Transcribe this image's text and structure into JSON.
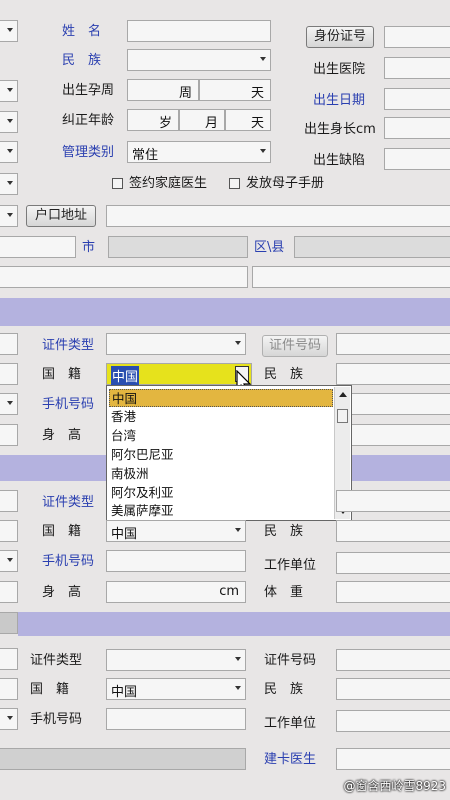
{
  "top": {
    "name_label": "姓　名",
    "ethnicity_label": "民　族",
    "birth_gestation_label": "出生孕周",
    "gestation_week_unit": "周",
    "gestation_day_unit": "天",
    "corrected_age_label": "纠正年龄",
    "age_year_unit": "岁",
    "age_month_unit": "月",
    "age_day_unit": "天",
    "management_type_label": "管理类别",
    "management_type_value": "常住",
    "id_number_button": "身份证号",
    "birth_hospital_label": "出生医院",
    "birth_date_label": "出生日期",
    "birth_height_label": "出生身长cm",
    "birth_defect_label": "出生缺陷",
    "family_doctor_checkbox": "签约家庭医生",
    "maternal_handbook_checkbox": "发放母子手册",
    "household_address_button": "户口地址",
    "city_label": "市",
    "district_label": "区\\县"
  },
  "guardian1": {
    "cert_type_label": "证件类型",
    "cert_number_button": "证件号码",
    "nationality_label": "国　籍",
    "nationality_value": "中国",
    "ethnicity_label": "民　族",
    "phone_label": "手机号码",
    "height_label": "身　高"
  },
  "dropdown": {
    "options": [
      "中国",
      "香港",
      "台湾",
      "阿尔巴尼亚",
      "南极洲",
      "阿尔及利亚",
      "美属萨摩亚"
    ]
  },
  "guardian2": {
    "cert_type_label": "证件类型",
    "nationality_label": "国　籍",
    "nationality_value": "中国",
    "ethnicity_label": "民　族",
    "phone_label": "手机号码",
    "work_unit_label": "工作单位",
    "height_label": "身　高",
    "height_unit": "cm",
    "weight_label": "体　重"
  },
  "guardian3": {
    "cert_type_label": "证件类型",
    "cert_number_label": "证件号码",
    "nationality_label": "国　籍",
    "nationality_value": "中国",
    "ethnicity_label": "民　族",
    "phone_label": "手机号码",
    "work_unit_label": "工作单位",
    "card_doctor_label": "建卡医生"
  },
  "watermark": "@窗含西岭雪8923",
  "colors": {
    "section_bar": "#b4b2df",
    "highlight_field": "#e6e21c",
    "dropdown_selected": "#e3b640",
    "blue_label": "#2a3fb0"
  }
}
